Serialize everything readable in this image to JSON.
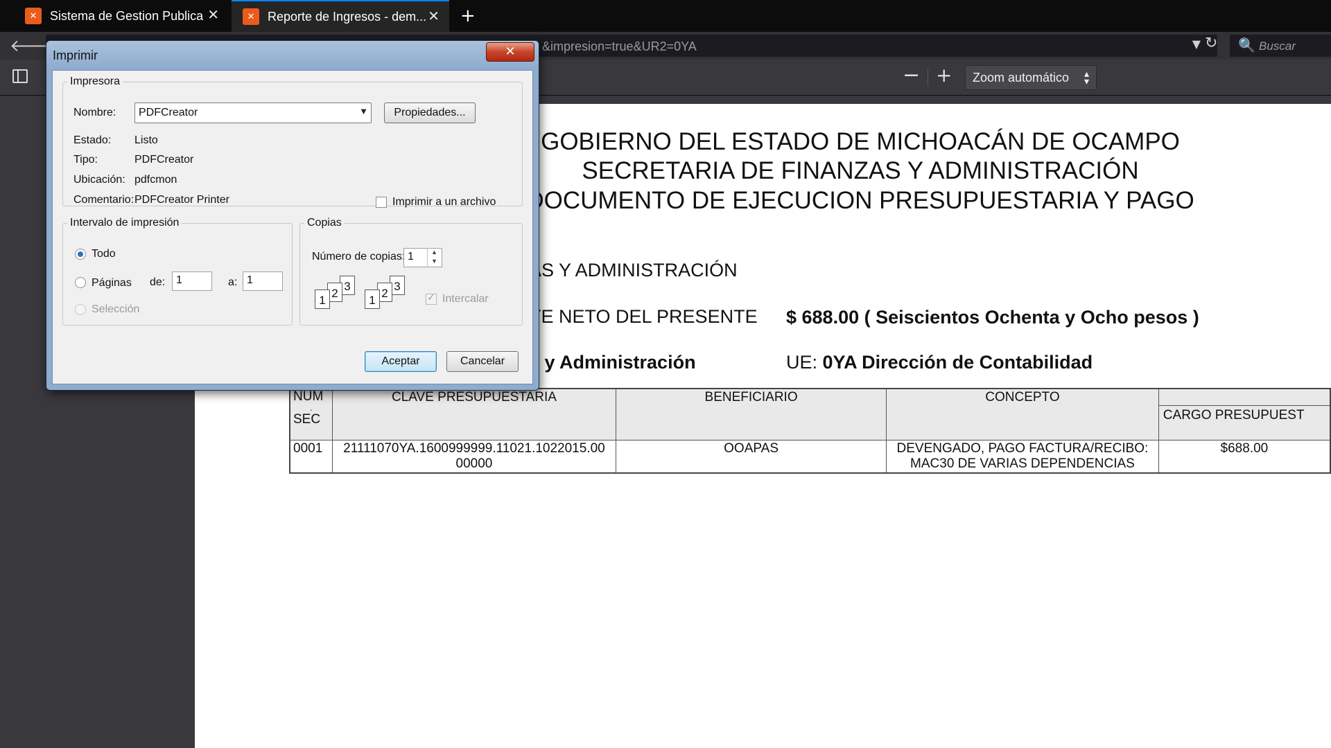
{
  "browser": {
    "tabs": [
      {
        "title": "Sistema de Gestion Publica",
        "favicon": "xampp-icon"
      },
      {
        "title": "Reporte de Ingresos - dem...",
        "favicon": "xampp-icon",
        "active": true
      }
    ],
    "new_tab_symbol": "+",
    "url": "&impresion=true&UR2=0YA",
    "search_placeholder": "Buscar",
    "icons": {
      "back": "arrow-left-icon",
      "reload": "reload-icon",
      "search": "search-icon",
      "dropdown": "chevron-down-icon"
    }
  },
  "pdf_toolbar": {
    "zoom_out": "−",
    "zoom_in": "+",
    "zoom_value": "Zoom automático"
  },
  "document": {
    "title_lines": [
      "GOBIERNO DEL ESTADO DE MICHOACÁN DE OCAMPO",
      "SECRETARIA DE FINANZAS Y ADMINISTRACIÓN",
      "DOCUMENTO DE EJECUCION PRESUPUESTARIA Y PAGO"
    ],
    "dependency_line": "AS Y ADMINISTRACIÓN",
    "amount_label": "TE NETO DEL PRESENTE",
    "amount_value": "$ 688.00 ( Seiscientos Ochenta y Ocho pesos )",
    "ur_fragment": "s y Administración",
    "ue_label": "UE:",
    "ue_value": "0YA Dirección de Contabilidad",
    "table": {
      "headers": [
        "NUM",
        ".",
        "SEC",
        "CLAVE PRESUPUESTARIA",
        "BENEFICIARIO",
        "CONCEPTO",
        "CARGO PRESUPUEST"
      ],
      "rows": [
        {
          "num": "0001",
          "clave_1": "21111070YA.1600999999.11021.1022015.00",
          "clave_2": "00000",
          "beneficiario": "OOAPAS",
          "concepto_1": "DEVENGADO, PAGO FACTURA/RECIBO:",
          "concepto_2": "MAC30 DE VARIAS DEPENDENCIAS",
          "cargo": "$688.00"
        }
      ]
    }
  },
  "print_dialog": {
    "title": "Imprimir",
    "close_symbol": "✕",
    "printer_group": "Impresora",
    "name_label": "Nombre:",
    "printer_name": "PDFCreator",
    "properties_button": "Propiedades...",
    "status_label": "Estado:",
    "status_value": "Listo",
    "type_label": "Tipo:",
    "type_value": "PDFCreator",
    "location_label": "Ubicación:",
    "location_value": "pdfcmon",
    "comment_label": "Comentario:",
    "comment_value": "PDFCreator Printer",
    "print_to_file": "Imprimir a un archivo",
    "range_group": "Intervalo de impresión",
    "range_all": "Todo",
    "range_pages": "Páginas",
    "from_label": "de:",
    "from_value": "1",
    "to_label": "a:",
    "to_value": "1",
    "range_selection": "Selección",
    "copies_group": "Copias",
    "copies_label": "Número de copias:",
    "copies_value": "1",
    "collate_label": "Intercalar",
    "collate_pages": [
      "1",
      "2",
      "3"
    ],
    "ok_button": "Aceptar",
    "cancel_button": "Cancelar"
  }
}
